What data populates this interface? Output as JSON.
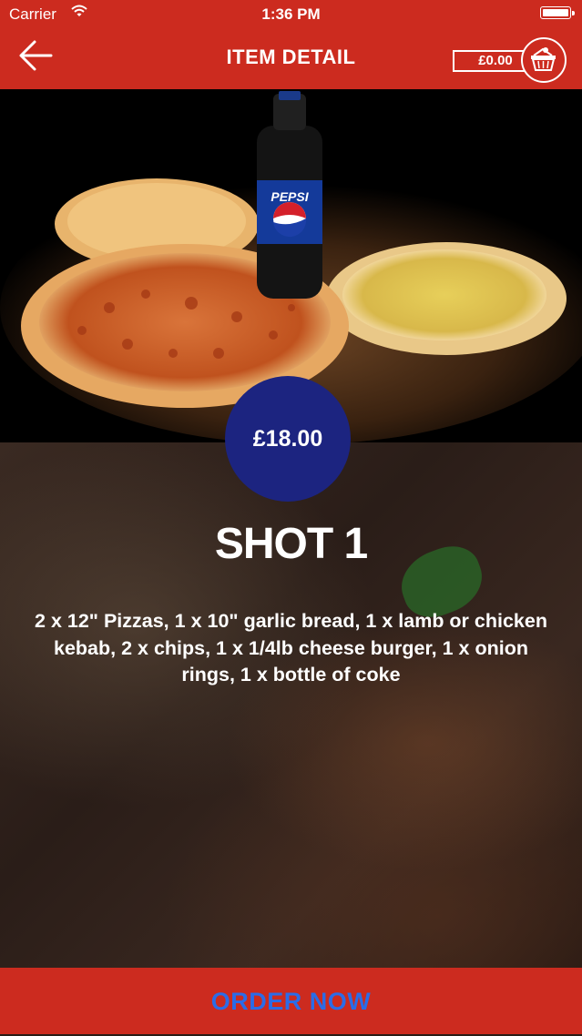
{
  "status_bar": {
    "carrier": "Carrier",
    "time": "1:36 PM"
  },
  "header": {
    "title": "ITEM DETAIL",
    "cart_total": "£0.00"
  },
  "item": {
    "price": "£18.00",
    "name": "SHOT 1",
    "description": "2 x 12\" Pizzas, 1 x 10\" garlic bread, 1 x lamb or chicken kebab, 2 x chips, 1 x 1/4lb cheese burger, 1 x onion rings, 1 x bottle of coke"
  },
  "footer": {
    "order_label": "ORDER NOW"
  },
  "colors": {
    "header_bg": "#cc2b1f",
    "price_badge": "#1c2480",
    "order_text": "#2a6ce8"
  },
  "icons": [
    "wifi-icon",
    "battery-icon",
    "back-arrow-icon",
    "basket-icon"
  ]
}
